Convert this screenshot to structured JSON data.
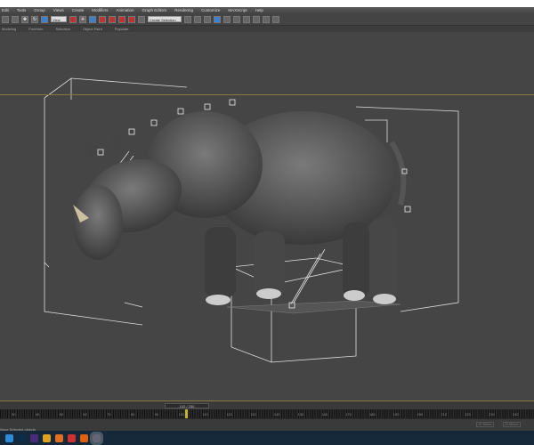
{
  "menu": [
    "Edit",
    "Tools",
    "Group",
    "Views",
    "Create",
    "Modifiers",
    "Animation",
    "Graph Editors",
    "Rendering",
    "Customize",
    "MAXScript",
    "Help"
  ],
  "toolbar": {
    "view_dropdown": "View",
    "selection_set": "Create Selection Set"
  },
  "ribbon": [
    "Modeling",
    "Freeform",
    "Selection",
    "Object Paint",
    "Populate"
  ],
  "timeline": {
    "frame_label": "102 / 250",
    "current_frame": 102,
    "total_frames": 250,
    "ticks": [
      "30",
      "40",
      "50",
      "60",
      "70",
      "80",
      "90",
      "100",
      "110",
      "120",
      "130",
      "140",
      "150",
      "160",
      "170",
      "180",
      "190",
      "200",
      "210",
      "220",
      "230",
      "240"
    ]
  },
  "status": {
    "text": "None Selected objects",
    "x": "-26.954cm",
    "y": "-20.654cm"
  },
  "taskbar": [
    {
      "name": "file-explorer",
      "color": "#2d8ad8"
    },
    {
      "name": "photoshop",
      "color": "#0c2d4a"
    },
    {
      "name": "premiere",
      "color": "#4a2a7a"
    },
    {
      "name": "chrome",
      "color": "#e0a020"
    },
    {
      "name": "blender",
      "color": "#e07020"
    },
    {
      "name": "app-red",
      "color": "#d03030"
    },
    {
      "name": "app-orange",
      "color": "#e06010"
    },
    {
      "name": "3dsmax",
      "color": "#667"
    }
  ]
}
